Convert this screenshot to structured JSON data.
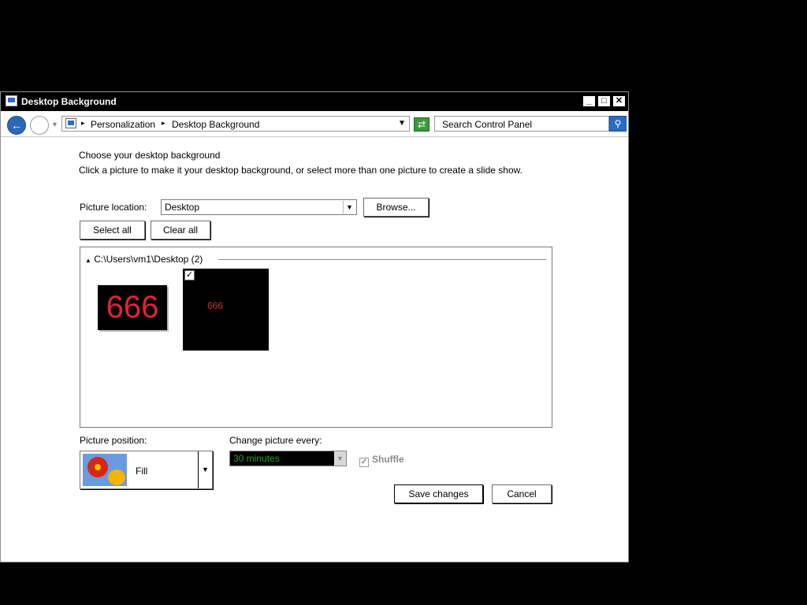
{
  "window": {
    "title": "Desktop Background",
    "minimize": "_",
    "maximize": "□",
    "close": "✕"
  },
  "addressbar": {
    "breadcrumb": [
      "Personalization",
      "Desktop Background"
    ],
    "search_placeholder": "Search Control Panel"
  },
  "content": {
    "heading": "Choose your desktop background",
    "description": "Click a picture to make it your desktop background, or select more than one picture to create a slide show.",
    "picture_location_label": "Picture location:",
    "picture_location_value": "Desktop",
    "browse_label": "Browse...",
    "select_all_label": "Select all",
    "clear_all_label": "Clear all",
    "gallery": {
      "group_label": "C:\\Users\\vm1\\Desktop (2)",
      "items": [
        {
          "text": "666",
          "checked": false
        },
        {
          "text": "666",
          "checked": true
        }
      ]
    },
    "picture_position_label": "Picture position:",
    "picture_position_value": "Fill",
    "change_picture_label": "Change picture every:",
    "change_picture_value": "30 minutes",
    "shuffle_label": "Shuffle",
    "shuffle_checked": true,
    "save_label": "Save changes",
    "cancel_label": "Cancel"
  },
  "colors": {
    "accent": "#2a6cc4",
    "thumb_text": "#e0233a",
    "interval_text": "#26a426"
  }
}
